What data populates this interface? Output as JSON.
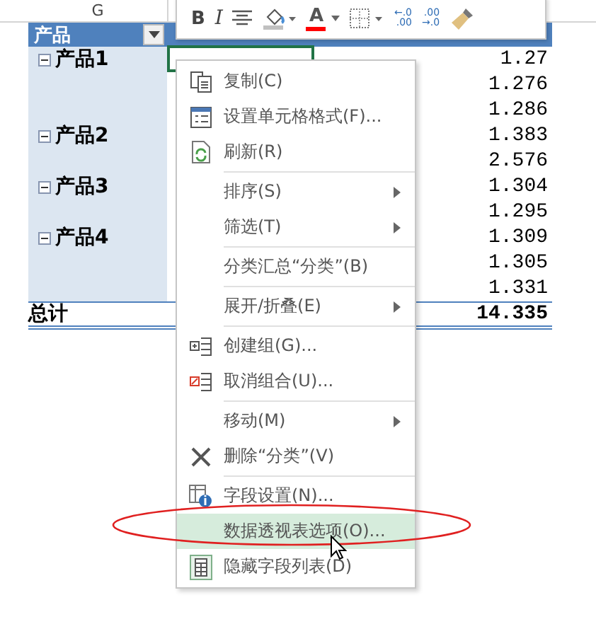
{
  "sheet": {
    "column_header": "G",
    "pivot_header": {
      "row_label": "产品"
    },
    "products": [
      {
        "label": "产品1",
        "values": [
          "1.27",
          "1.276",
          "1.286"
        ]
      },
      {
        "label": "产品2",
        "values": [
          "1.383",
          "2.576"
        ]
      },
      {
        "label": "产品3",
        "values": [
          "1.304",
          "1.295"
        ]
      },
      {
        "label": "产品4",
        "values": [
          "1.309",
          "1.305",
          "1.331"
        ]
      }
    ],
    "total": {
      "label": "总计",
      "value": "14.335"
    }
  },
  "toolbar": {
    "buttons": [
      {
        "kind": "bold",
        "text": "B"
      },
      {
        "kind": "italic",
        "text": "I"
      },
      {
        "kind": "align"
      },
      {
        "kind": "fill",
        "color": "#c0c0c0"
      },
      {
        "kind": "font_color",
        "text": "A",
        "color": "#ff0000"
      },
      {
        "kind": "border"
      },
      {
        "kind": "decimal",
        "top": "←.0",
        "bottom": ".00"
      },
      {
        "kind": "decimal",
        "top": ".00",
        "bottom": "→.0"
      },
      {
        "kind": "brush"
      }
    ]
  },
  "context_menu": {
    "items": [
      {
        "label": "复制(C)",
        "submenu": false,
        "highlighted": false,
        "separator_before": false
      },
      {
        "label": "设置单元格格式(F)...",
        "submenu": false,
        "highlighted": false,
        "separator_before": false
      },
      {
        "label": "刷新(R)",
        "submenu": false,
        "highlighted": false,
        "separator_before": false
      },
      {
        "label": "排序(S)",
        "submenu": true,
        "highlighted": false,
        "separator_before": true
      },
      {
        "label": "筛选(T)",
        "submenu": true,
        "highlighted": false,
        "separator_before": false
      },
      {
        "label": "分类汇总“分类”(B)",
        "submenu": false,
        "highlighted": false,
        "separator_before": true
      },
      {
        "label": "展开/折叠(E)",
        "submenu": true,
        "highlighted": false,
        "separator_before": true
      },
      {
        "label": "创建组(G)...",
        "submenu": false,
        "highlighted": false,
        "separator_before": true
      },
      {
        "label": "取消组合(U)...",
        "submenu": false,
        "highlighted": false,
        "separator_before": false
      },
      {
        "label": "移动(M)",
        "submenu": true,
        "highlighted": false,
        "separator_before": true
      },
      {
        "label": "删除“分类”(V)",
        "submenu": false,
        "highlighted": false,
        "separator_before": false
      },
      {
        "label": "字段设置(N)...",
        "submenu": false,
        "highlighted": false,
        "separator_before": true
      },
      {
        "label": "数据透视表选项(O)...",
        "submenu": false,
        "highlighted": true,
        "separator_before": false
      },
      {
        "label": "隐藏字段列表(D)",
        "submenu": false,
        "highlighted": false,
        "separator_before": false
      }
    ]
  }
}
